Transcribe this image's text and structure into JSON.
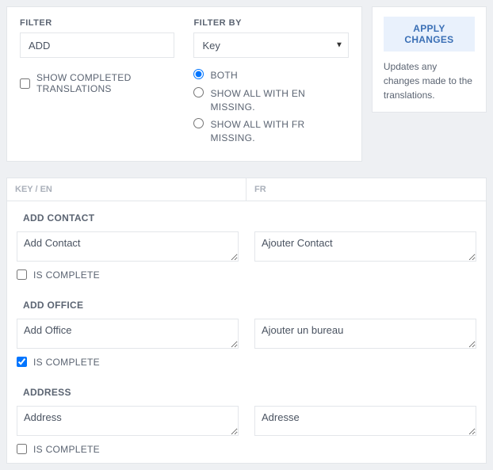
{
  "filter": {
    "label": "FILTER",
    "value": "ADD",
    "show_completed_label": "SHOW COMPLETED TRANSLATIONS",
    "show_completed_checked": false
  },
  "filter_by": {
    "label": "FILTER BY",
    "selected": "Key",
    "radios": [
      {
        "label": "BOTH",
        "checked": true
      },
      {
        "label": "SHOW ALL WITH EN MISSING.",
        "checked": false
      },
      {
        "label": "SHOW ALL WITH FR MISSING.",
        "checked": false
      }
    ]
  },
  "side": {
    "apply_label": "APPLY CHANGES",
    "description": "Updates any changes made to the translations."
  },
  "table": {
    "col_key": "KEY / EN",
    "col_fr": "FR",
    "is_complete_label": "IS COMPLETE",
    "entries": [
      {
        "key": "ADD CONTACT",
        "en": "Add Contact",
        "fr": "Ajouter Contact",
        "complete": false
      },
      {
        "key": "ADD OFFICE",
        "en": "Add Office",
        "fr": "Ajouter un bureau",
        "complete": true
      },
      {
        "key": "ADDRESS",
        "en": "Address",
        "fr": "Adresse",
        "complete": false
      }
    ]
  }
}
